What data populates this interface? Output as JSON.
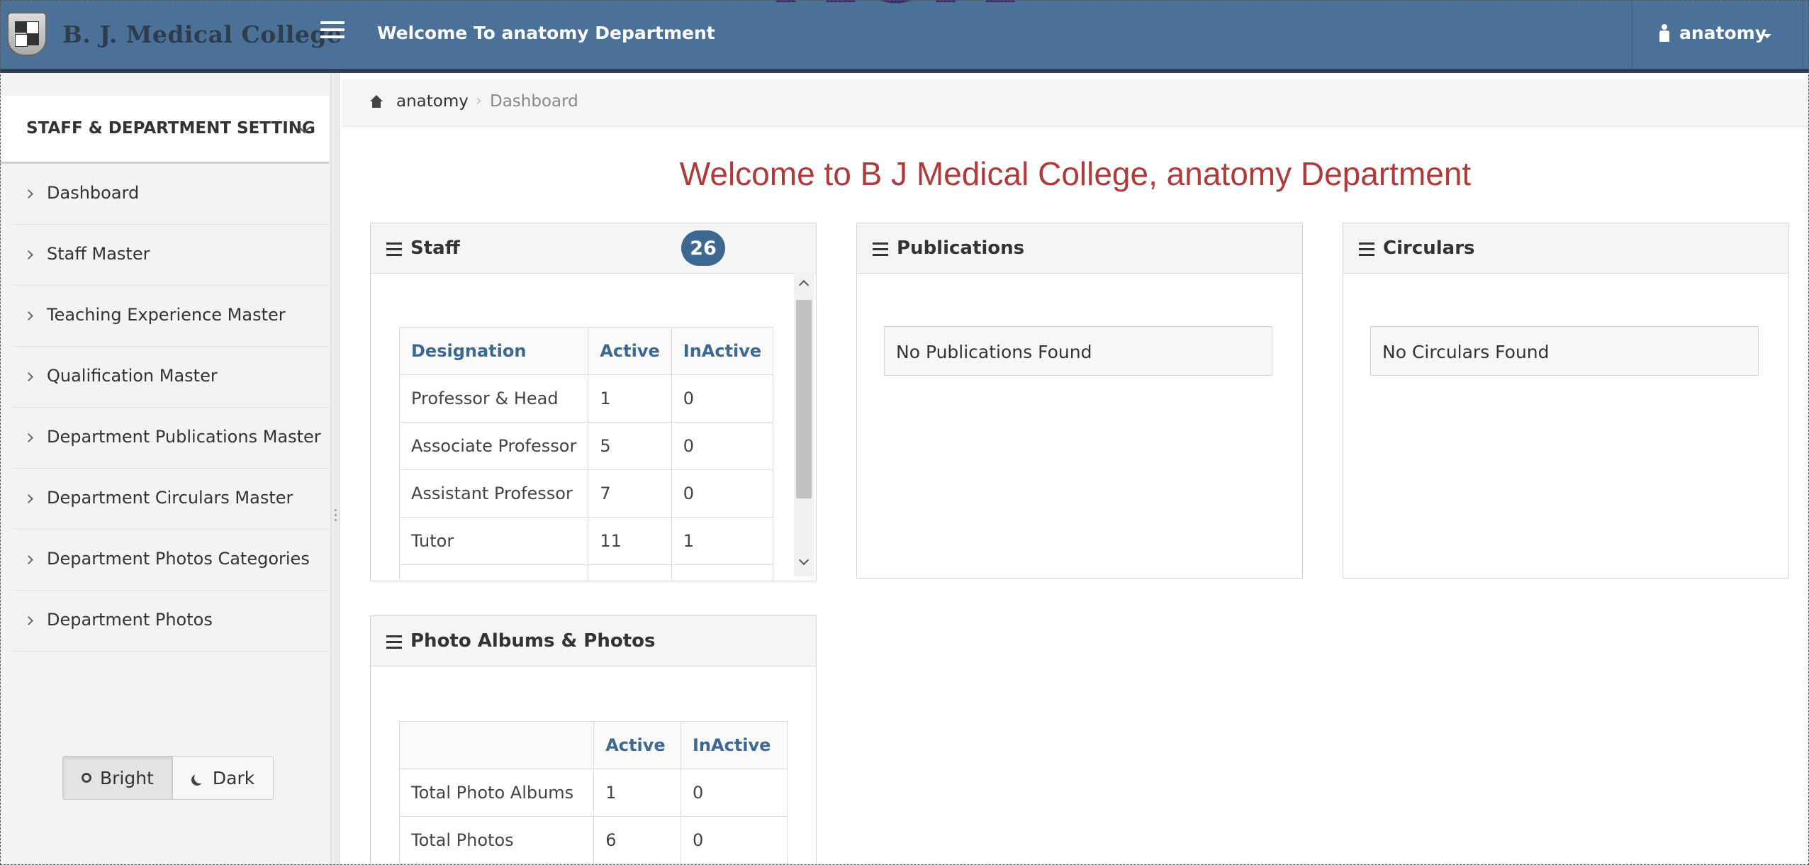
{
  "header": {
    "brand": "B. J. Medical College",
    "welcome": "Welcome To anatomy Department",
    "user": "anatomy"
  },
  "sidebar": {
    "section_title": "STAFF & DEPARTMENT SETTING",
    "items": [
      {
        "label": "Dashboard"
      },
      {
        "label": "Staff Master"
      },
      {
        "label": "Teaching Experience Master"
      },
      {
        "label": "Qualification Master"
      },
      {
        "label": "Department Publications Master"
      },
      {
        "label": "Department Circulars Master"
      },
      {
        "label": "Department Photos Categories"
      },
      {
        "label": "Department Photos"
      }
    ],
    "theme": {
      "bright": "Bright",
      "dark": "Dark",
      "selected": "Bright"
    }
  },
  "breadcrumb": {
    "home": "anatomy",
    "current": "Dashboard"
  },
  "page_title": "Welcome to B J Medical College, anatomy Department",
  "staff_panel": {
    "title": "Staff",
    "count": "26",
    "headers": [
      "Designation",
      "Active",
      "InActive"
    ],
    "rows": [
      [
        "Professor & Head",
        "1",
        "0"
      ],
      [
        "Associate Professor",
        "5",
        "0"
      ],
      [
        "Assistant Professor",
        "7",
        "0"
      ],
      [
        "Tutor",
        "11",
        "1"
      ]
    ]
  },
  "publications_panel": {
    "title": "Publications",
    "empty": "No Publications Found"
  },
  "circulars_panel": {
    "title": "Circulars",
    "empty": "No Circulars Found"
  },
  "photos_panel": {
    "title": "Photo Albums & Photos",
    "headers": [
      "",
      "Active",
      "InActive"
    ],
    "rows": [
      [
        "Total Photo Albums",
        "1",
        "0"
      ],
      [
        "Total Photos",
        "6",
        "0"
      ]
    ]
  },
  "colors": {
    "navbar": "#4b7199",
    "accent": "#3d6891",
    "title_red": "#b03a3a"
  }
}
